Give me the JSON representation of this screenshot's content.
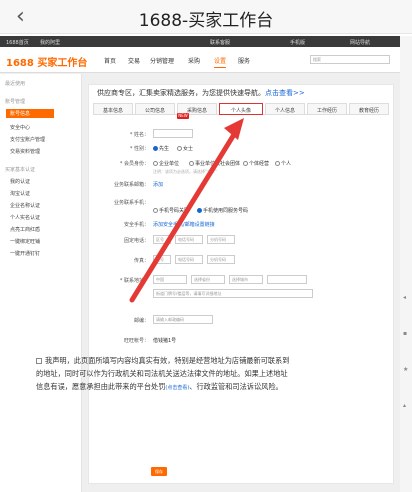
{
  "appbar": {
    "back_icon": "chevron-left-icon",
    "title": "1688-买家工作台"
  },
  "topstrip": {
    "items": [
      "1688首页",
      "我的阿里",
      "联系客服",
      "手机版",
      "网站导航"
    ]
  },
  "header": {
    "logo": "1688 买家工作台",
    "nav": [
      "首页",
      "交易",
      "分销管理",
      "采购",
      "设置",
      "服务"
    ],
    "active_nav": "设置",
    "search_placeholder": "搜索"
  },
  "sidebar": {
    "sections": [
      {
        "title": "最近使用",
        "items": []
      },
      {
        "title": "账号管理",
        "items": [
          "账号信息",
          "安全中心",
          "支付宝账户管理",
          "交易资料管理"
        ]
      },
      {
        "title": "买家基本认证",
        "items": [
          "我的认证",
          "淘宝认证",
          "企业名称认证",
          "个人实名认证",
          "点亮工商红盾",
          "一键绑定旺铺",
          "一键开通钉钉"
        ]
      }
    ],
    "active_item": "账号信息"
  },
  "banner": {
    "text": "供应商专区，汇集卖家精选服务，为您提供快速导航。",
    "link": "点击查看>>"
  },
  "tabs": [
    "基本信息",
    "公司信息",
    "采购信息",
    "个人头像",
    "个人信息",
    "工作经历",
    "教育经历"
  ],
  "active_tab": "个人头像",
  "tab_badge": "NEW",
  "form": {
    "name_label": "* 姓名：",
    "gender_label": "* 性别：",
    "gender_options": [
      "先生",
      "女士"
    ],
    "identity_label": "* 会员身份：",
    "identity_options": [
      "企业单位",
      "事业单位或社会团体",
      "个体经营",
      "个人"
    ],
    "identity_hint": "注明：该项为必选项，请选择\"个人\"",
    "email_label": "业务联系邮箱：",
    "email_value": "添加",
    "mobile_label": "业务联系手机：",
    "mobile_options": [
      "手机号码关联",
      "手机使用同服务号码"
    ],
    "security_label": "安全手机：",
    "security_value": "添加安全手机/邮箱设置链接",
    "phone_label": "固定电话：",
    "phone_placeholders": [
      "区号",
      "电话号码",
      "分机号码"
    ],
    "fax_label": "传真：",
    "fax_placeholders": [
      "区号",
      "电话号码",
      "分机号码"
    ],
    "address_label": "* 联系地址：",
    "address_selects": [
      "中国",
      "选择省份",
      "选择城市"
    ],
    "street_placeholder": "街道门牌号/楼层等，请填写详细地址",
    "zip_label": "邮编：",
    "zip_placeholder": "请输入邮政编码",
    "wangwang_label": "旺旺帐号：",
    "wangwang_value": "借钱猪1号"
  },
  "statement": {
    "text": "我声明，此页面所填写内容均真实有效，特别是经营地址为店铺最新可联系到的地址，同时可以作为行政机关和司法机关送达法律文件的地址。如果上述地址信息有误，愿意承担由此带来的平台处罚",
    "link": "(点击查看)",
    "tail": "、行政监管和司法诉讼风险。"
  },
  "save_label": "保存",
  "rightbar_icons": [
    "share-icon",
    "qrcode-icon",
    "star-icon",
    "up-icon"
  ],
  "colors": {
    "accent": "#ff6a00",
    "link": "#1766d6",
    "highlight": "#d32f2f",
    "arrow": "#e53935"
  }
}
